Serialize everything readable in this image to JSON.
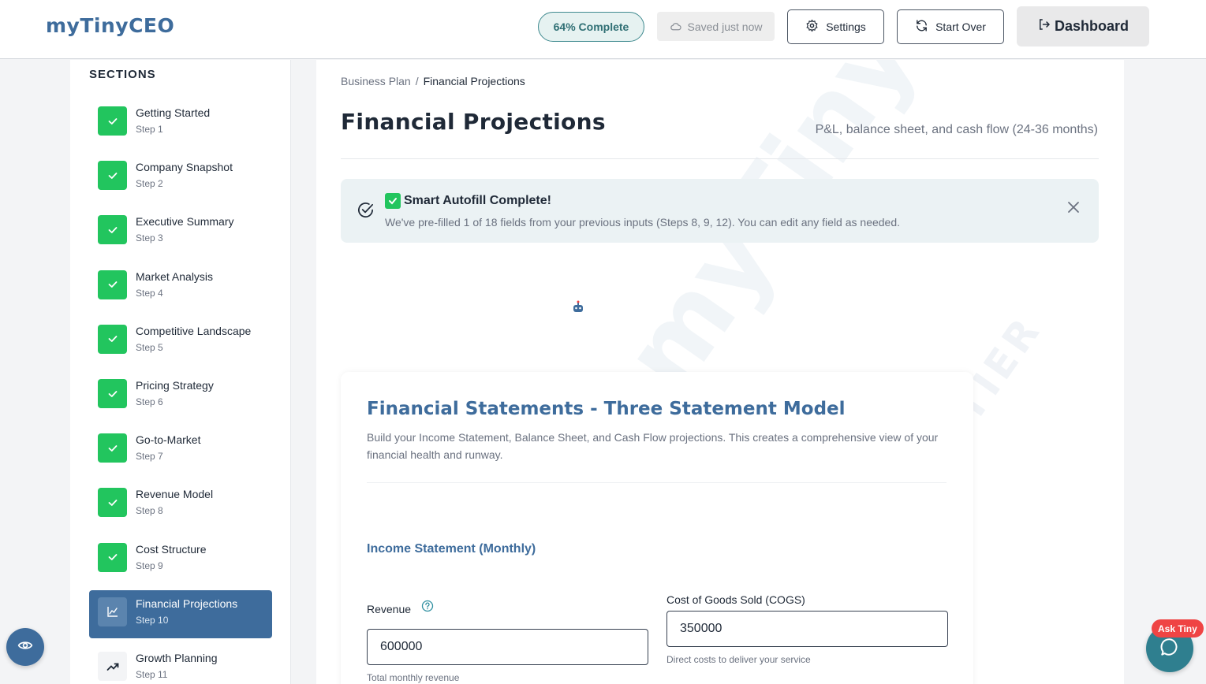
{
  "header": {
    "logo": "myTinyCEO",
    "progress": "64% Complete",
    "progress_fraction": 0.64,
    "saved": "Saved just now",
    "settings_label": "Settings",
    "start_over_label": "Start Over",
    "dashboard_label": "Dashboard"
  },
  "sidebar": {
    "title": "SECTIONS",
    "items": [
      {
        "label": "Getting Started",
        "step": "Step 1",
        "state": "complete"
      },
      {
        "label": "Company Snapshot",
        "step": "Step 2",
        "state": "complete"
      },
      {
        "label": "Executive Summary",
        "step": "Step 3",
        "state": "complete"
      },
      {
        "label": "Market Analysis",
        "step": "Step 4",
        "state": "complete"
      },
      {
        "label": "Competitive Landscape",
        "step": "Step 5",
        "state": "complete"
      },
      {
        "label": "Pricing Strategy",
        "step": "Step 6",
        "state": "complete"
      },
      {
        "label": "Go-to-Market",
        "step": "Step 7",
        "state": "complete"
      },
      {
        "label": "Revenue Model",
        "step": "Step 8",
        "state": "complete"
      },
      {
        "label": "Cost Structure",
        "step": "Step 9",
        "state": "complete"
      },
      {
        "label": "Financial Projections",
        "step": "Step 10",
        "state": "active"
      },
      {
        "label": "Growth Planning",
        "step": "Step 11",
        "state": "future"
      }
    ]
  },
  "main": {
    "breadcrumb": {
      "root": "Business Plan",
      "sep": "/",
      "current": "Financial Projections"
    },
    "title": "Financial Projections",
    "subtitle": "P&L, balance sheet, and cash flow (24-36 months)",
    "alert": {
      "title": "Smart Autofill Complete!",
      "text": "We've pre-filled 1 of 18 fields from your previous inputs (Steps 8, 9, 12). You can edit any field as needed."
    },
    "watermark": "myTinyCEO",
    "watermark_tier": "FREE TIER",
    "card": {
      "title": "Financial Statements - Three Statement Model",
      "description": "Build your Income Statement, Balance Sheet, and Cash Flow projections. This creates a comprehensive view of your financial health and runway.",
      "section_heading": "Income Statement (Monthly)",
      "fields": {
        "revenue": {
          "label": "Revenue",
          "value": "600000",
          "help": "Total monthly revenue"
        },
        "cogs": {
          "label": "Cost of Goods Sold (COGS)",
          "value": "350000",
          "help": "Direct costs to deliver your service"
        }
      }
    }
  },
  "floating": {
    "ask_badge": "Ask Tiny"
  },
  "colors": {
    "brand": "#3e6c9c",
    "success": "#22c55e",
    "teal": "#2f7f8f",
    "danger": "#ef4444"
  }
}
